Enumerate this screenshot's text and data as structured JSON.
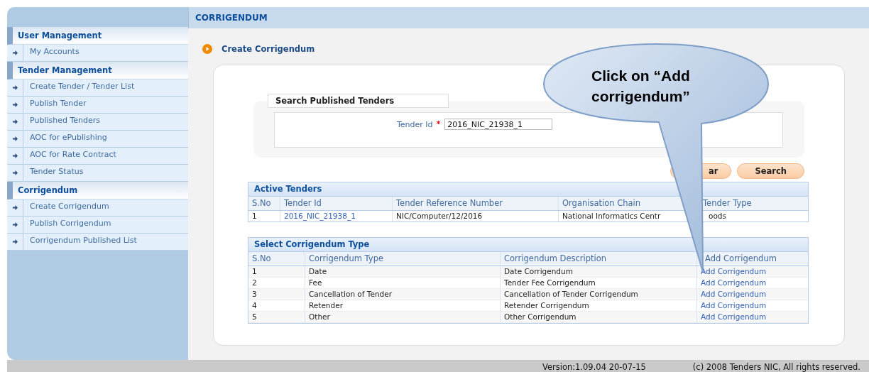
{
  "header": {
    "title": "CORRIGENDUM"
  },
  "sidebar": {
    "sections": [
      {
        "title": "User Management",
        "items": [
          "My Accounts"
        ]
      },
      {
        "title": "Tender Management",
        "items": [
          "Create Tender / Tender List",
          "Publish Tender",
          "Published Tenders",
          "AOC for ePublishing",
          "AOC for Rate Contract",
          "Tender Status"
        ]
      },
      {
        "title": "Corrigendum",
        "items": [
          "Create Corrigendum",
          "Publish Corrigendum",
          "Corrigendum Published List"
        ]
      }
    ]
  },
  "page_title": "Create Corrigendum",
  "search": {
    "legend": "Search Published Tenders",
    "label": "Tender Id",
    "required_mark": "*",
    "value": "2016_NIC_21938_1",
    "buttons": [
      "ar",
      "Search"
    ]
  },
  "active_tenders": {
    "title": "Active Tenders",
    "columns": [
      {
        "label": "S.No",
        "kind": "text"
      },
      {
        "label": "Tender Id",
        "kind": "link"
      },
      {
        "label": "Tender Reference Number",
        "kind": "text"
      },
      {
        "label": "Organisation Chain",
        "kind": "text"
      },
      {
        "label": "Tender Type",
        "kind": "text"
      }
    ],
    "rows": [
      [
        "1",
        "2016_NIC_21938_1",
        "NIC/Computer/12/2016",
        "National Informatics Centr",
        "oods"
      ]
    ]
  },
  "corrigendum_types": {
    "title": "Select Corrigendum Type",
    "columns": [
      {
        "label": "S.No",
        "kind": "text"
      },
      {
        "label": "Corrigendum Type",
        "kind": "text"
      },
      {
        "label": "Corrigendum Description",
        "kind": "text"
      },
      {
        "label": "Add Corrigendum",
        "kind": "link"
      }
    ],
    "rows": [
      [
        "1",
        "Date",
        "Date Corrigendum",
        "Add Corrigendum"
      ],
      [
        "2",
        "Fee",
        "Tender Fee Corrigendum",
        "Add Corrigendum"
      ],
      [
        "3",
        "Cancellation of Tender",
        "Cancellation of Tender Corrigendum",
        "Add Corrigendum"
      ],
      [
        "4",
        "Retender",
        "Retender Corrigendum",
        "Add Corrigendum"
      ],
      [
        "5",
        "Other",
        "Other Corrigendum",
        "Add Corrigendum"
      ]
    ]
  },
  "callout": {
    "text": "Click on “Add corrigendum”"
  },
  "status_bar": {
    "version": "Version:1.09.04 20-07-15",
    "copyright": "(c) 2008 Tenders NIC, All rights reserved."
  }
}
